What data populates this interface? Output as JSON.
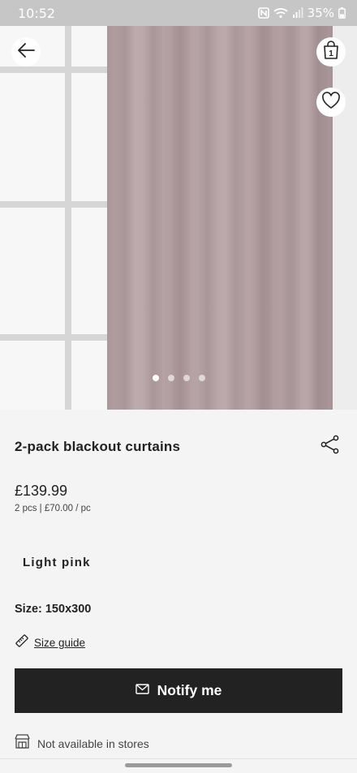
{
  "status_bar": {
    "time": "10:52",
    "battery": "35%",
    "icons": [
      "nfc-icon",
      "wifi-icon",
      "signal-icon",
      "battery-icon"
    ]
  },
  "gallery": {
    "dots": 4,
    "active_index": 0
  },
  "header_buttons": {
    "back_icon": "arrow-left-icon",
    "bag_icon": "shopping-bag-icon",
    "bag_count": "1",
    "wishlist_icon": "heart-icon"
  },
  "product": {
    "title": "2-pack blackout curtains",
    "price": "£139.99",
    "unit_price": "2 pcs | £70.00 / pc",
    "color": "Light pink",
    "size": "Size: 150x300"
  },
  "links": {
    "size_guide": "Size guide"
  },
  "cta": {
    "notify_label": "Notify me"
  },
  "availability": {
    "store_text": "Not available in stores"
  },
  "colors": {
    "cta_bg": "#222222",
    "page_bg": "#f4f4f4",
    "curtain": "#b09c9e"
  }
}
